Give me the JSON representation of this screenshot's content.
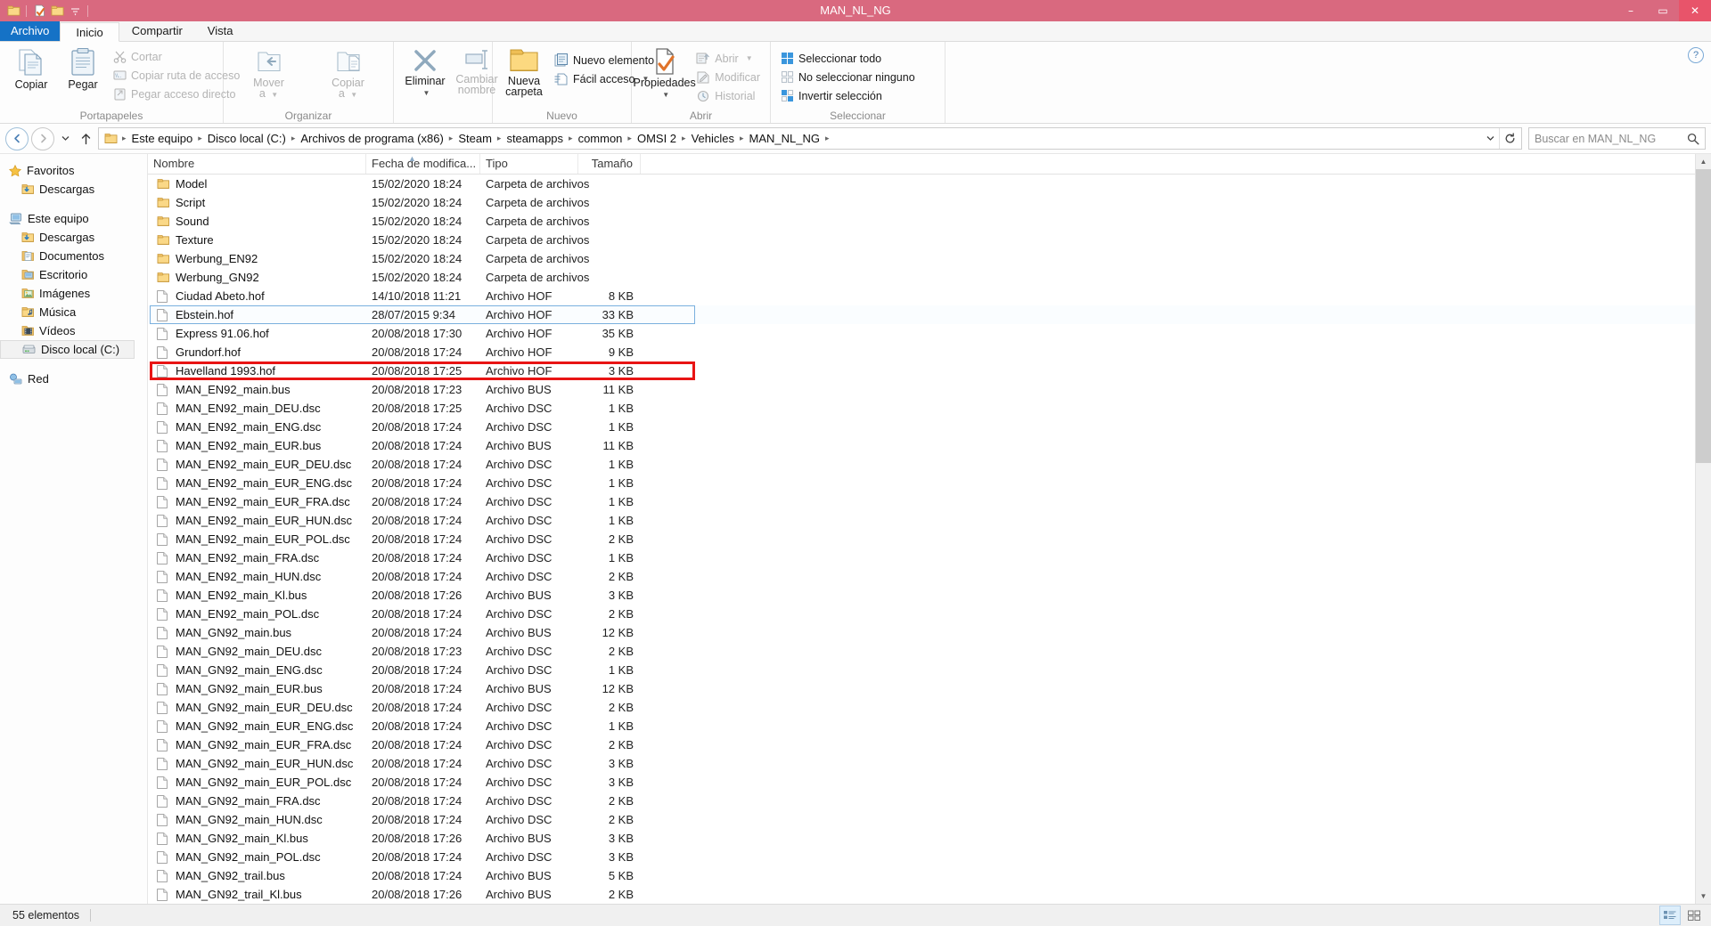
{
  "window": {
    "title": "MAN_NL_NG",
    "titlebar_color": "#d9697f",
    "accent_color": "#1572c6",
    "minimize": "–",
    "maximize": "▭",
    "close": "✕",
    "quick_access": [
      "folder-icon",
      "properties-icon",
      "new-folder-icon",
      "customize-qat-icon"
    ]
  },
  "tabs": [
    {
      "label": "Archivo",
      "type": "file"
    },
    {
      "label": "Inicio",
      "type": "active"
    },
    {
      "label": "Compartir",
      "type": "normal"
    },
    {
      "label": "Vista",
      "type": "normal"
    }
  ],
  "ribbon": {
    "help_label": "?",
    "groups": [
      {
        "name": "Portapapeles",
        "big": [
          {
            "label": "Copiar",
            "icon": "copy-icon",
            "dim": false
          },
          {
            "label": "Pegar",
            "icon": "paste-icon",
            "dim": false
          }
        ],
        "small": [
          {
            "label": "Cortar",
            "icon": "cut-icon",
            "dim": true
          },
          {
            "label": "Copiar ruta de acceso",
            "icon": "copy-path-icon",
            "dim": true
          },
          {
            "label": "Pegar acceso directo",
            "icon": "paste-shortcut-icon",
            "dim": true
          }
        ]
      },
      {
        "name": "Organizar",
        "big": [
          {
            "label": "Mover\na",
            "icon": "move-to-icon",
            "dim": true,
            "caret": true
          },
          {
            "label": "Copiar\na",
            "icon": "copy-to-icon",
            "dim": true,
            "caret": true
          },
          {
            "label": "Eliminar",
            "icon": "delete-icon",
            "dim": false,
            "caret": true
          },
          {
            "label": "Cambiar\nnombre",
            "icon": "rename-icon",
            "dim": true,
            "caret": false
          }
        ],
        "small": []
      },
      {
        "name": "Nuevo",
        "big": [
          {
            "label": "Nueva\ncarpeta",
            "icon": "new-folder-icon",
            "dim": false
          }
        ],
        "small": [
          {
            "label": "Nuevo elemento",
            "icon": "new-item-icon",
            "dim": false,
            "caret": true
          },
          {
            "label": "Fácil acceso",
            "icon": "easy-access-icon",
            "dim": false,
            "caret": true
          }
        ]
      },
      {
        "name": "Abrir",
        "big": [
          {
            "label": "Propiedades",
            "icon": "properties-icon",
            "dim": false,
            "caret": true
          }
        ],
        "small": [
          {
            "label": "Abrir",
            "icon": "open-icon",
            "dim": true,
            "caret": true
          },
          {
            "label": "Modificar",
            "icon": "edit-icon",
            "dim": true
          },
          {
            "label": "Historial",
            "icon": "history-icon",
            "dim": true
          }
        ]
      },
      {
        "name": "Seleccionar",
        "big": [],
        "small": [
          {
            "label": "Seleccionar todo",
            "icon": "select-all-icon",
            "dim": false
          },
          {
            "label": "No seleccionar ninguno",
            "icon": "select-none-icon",
            "dim": false
          },
          {
            "label": "Invertir selección",
            "icon": "invert-selection-icon",
            "dim": false
          }
        ]
      }
    ]
  },
  "address": {
    "back_icon": "back-arrow-icon",
    "forward_icon": "forward-arrow-icon",
    "recent_icon": "chevron-down-icon",
    "up_icon": "up-arrow-icon",
    "breadcrumbs": [
      "Este equipo",
      "Disco local (C:)",
      "Archivos de programa (x86)",
      "Steam",
      "steamapps",
      "common",
      "OMSI 2",
      "Vehicles",
      "MAN_NL_NG"
    ],
    "dropdown_icon": "chevron-down-icon",
    "refresh_icon": "refresh-icon",
    "separator": "▸"
  },
  "search": {
    "placeholder": "Buscar en MAN_NL_NG",
    "icon": "search-icon",
    "value": ""
  },
  "nav_pane": {
    "sections": [
      {
        "header": {
          "label": "Favoritos",
          "icon": "star-icon"
        },
        "items": [
          {
            "label": "Descargas",
            "icon": "downloads-folder-icon"
          }
        ]
      },
      {
        "header": {
          "label": "Este equipo",
          "icon": "computer-icon"
        },
        "items": [
          {
            "label": "Descargas",
            "icon": "downloads-folder-icon"
          },
          {
            "label": "Documentos",
            "icon": "documents-folder-icon"
          },
          {
            "label": "Escritorio",
            "icon": "desktop-folder-icon"
          },
          {
            "label": "Imágenes",
            "icon": "pictures-folder-icon"
          },
          {
            "label": "Música",
            "icon": "music-folder-icon"
          },
          {
            "label": "Vídeos",
            "icon": "videos-folder-icon"
          },
          {
            "label": "Disco local (C:)",
            "icon": "drive-icon",
            "selected": true
          }
        ]
      },
      {
        "header": {
          "label": "Red",
          "icon": "network-icon"
        },
        "items": []
      }
    ]
  },
  "file_list": {
    "columns": [
      {
        "label": "Nombre",
        "key": "name"
      },
      {
        "label": "Fecha de modifica...",
        "key": "date"
      },
      {
        "label": "Tipo",
        "key": "type"
      },
      {
        "label": "Tamaño",
        "key": "size"
      }
    ],
    "sort_column": "Nombre",
    "sort_direction": "asc",
    "rows": [
      {
        "name": "Model",
        "date": "15/02/2020 18:24",
        "type": "Carpeta de archivos",
        "size": "",
        "icon": "folder-icon"
      },
      {
        "name": "Script",
        "date": "15/02/2020 18:24",
        "type": "Carpeta de archivos",
        "size": "",
        "icon": "folder-icon"
      },
      {
        "name": "Sound",
        "date": "15/02/2020 18:24",
        "type": "Carpeta de archivos",
        "size": "",
        "icon": "folder-icon"
      },
      {
        "name": "Texture",
        "date": "15/02/2020 18:24",
        "type": "Carpeta de archivos",
        "size": "",
        "icon": "folder-icon"
      },
      {
        "name": "Werbung_EN92",
        "date": "15/02/2020 18:24",
        "type": "Carpeta de archivos",
        "size": "",
        "icon": "folder-icon"
      },
      {
        "name": "Werbung_GN92",
        "date": "15/02/2020 18:24",
        "type": "Carpeta de archivos",
        "size": "",
        "icon": "folder-icon"
      },
      {
        "name": "Ciudad Abeto.hof",
        "date": "14/10/2018 11:21",
        "type": "Archivo HOF",
        "size": "8 KB",
        "icon": "file-icon"
      },
      {
        "name": "Ebstein.hof",
        "date": "28/07/2015 9:34",
        "type": "Archivo HOF",
        "size": "33 KB",
        "icon": "file-icon",
        "selected": true
      },
      {
        "name": "Express 91.06.hof",
        "date": "20/08/2018 17:30",
        "type": "Archivo HOF",
        "size": "35 KB",
        "icon": "file-icon"
      },
      {
        "name": "Grundorf.hof",
        "date": "20/08/2018 17:24",
        "type": "Archivo HOF",
        "size": "9 KB",
        "icon": "file-icon",
        "highlighted": true
      },
      {
        "name": "Havelland 1993.hof",
        "date": "20/08/2018 17:25",
        "type": "Archivo HOF",
        "size": "3 KB",
        "icon": "file-icon"
      },
      {
        "name": "MAN_EN92_main.bus",
        "date": "20/08/2018 17:23",
        "type": "Archivo BUS",
        "size": "11 KB",
        "icon": "file-icon"
      },
      {
        "name": "MAN_EN92_main_DEU.dsc",
        "date": "20/08/2018 17:25",
        "type": "Archivo DSC",
        "size": "1 KB",
        "icon": "file-icon"
      },
      {
        "name": "MAN_EN92_main_ENG.dsc",
        "date": "20/08/2018 17:24",
        "type": "Archivo DSC",
        "size": "1 KB",
        "icon": "file-icon"
      },
      {
        "name": "MAN_EN92_main_EUR.bus",
        "date": "20/08/2018 17:24",
        "type": "Archivo BUS",
        "size": "11 KB",
        "icon": "file-icon"
      },
      {
        "name": "MAN_EN92_main_EUR_DEU.dsc",
        "date": "20/08/2018 17:24",
        "type": "Archivo DSC",
        "size": "1 KB",
        "icon": "file-icon"
      },
      {
        "name": "MAN_EN92_main_EUR_ENG.dsc",
        "date": "20/08/2018 17:24",
        "type": "Archivo DSC",
        "size": "1 KB",
        "icon": "file-icon"
      },
      {
        "name": "MAN_EN92_main_EUR_FRA.dsc",
        "date": "20/08/2018 17:24",
        "type": "Archivo DSC",
        "size": "1 KB",
        "icon": "file-icon"
      },
      {
        "name": "MAN_EN92_main_EUR_HUN.dsc",
        "date": "20/08/2018 17:24",
        "type": "Archivo DSC",
        "size": "1 KB",
        "icon": "file-icon"
      },
      {
        "name": "MAN_EN92_main_EUR_POL.dsc",
        "date": "20/08/2018 17:24",
        "type": "Archivo DSC",
        "size": "2 KB",
        "icon": "file-icon"
      },
      {
        "name": "MAN_EN92_main_FRA.dsc",
        "date": "20/08/2018 17:24",
        "type": "Archivo DSC",
        "size": "1 KB",
        "icon": "file-icon"
      },
      {
        "name": "MAN_EN92_main_HUN.dsc",
        "date": "20/08/2018 17:24",
        "type": "Archivo DSC",
        "size": "2 KB",
        "icon": "file-icon"
      },
      {
        "name": "MAN_EN92_main_Kl.bus",
        "date": "20/08/2018 17:26",
        "type": "Archivo BUS",
        "size": "3 KB",
        "icon": "file-icon"
      },
      {
        "name": "MAN_EN92_main_POL.dsc",
        "date": "20/08/2018 17:24",
        "type": "Archivo DSC",
        "size": "2 KB",
        "icon": "file-icon"
      },
      {
        "name": "MAN_GN92_main.bus",
        "date": "20/08/2018 17:24",
        "type": "Archivo BUS",
        "size": "12 KB",
        "icon": "file-icon"
      },
      {
        "name": "MAN_GN92_main_DEU.dsc",
        "date": "20/08/2018 17:23",
        "type": "Archivo DSC",
        "size": "2 KB",
        "icon": "file-icon"
      },
      {
        "name": "MAN_GN92_main_ENG.dsc",
        "date": "20/08/2018 17:24",
        "type": "Archivo DSC",
        "size": "1 KB",
        "icon": "file-icon"
      },
      {
        "name": "MAN_GN92_main_EUR.bus",
        "date": "20/08/2018 17:24",
        "type": "Archivo BUS",
        "size": "12 KB",
        "icon": "file-icon"
      },
      {
        "name": "MAN_GN92_main_EUR_DEU.dsc",
        "date": "20/08/2018 17:24",
        "type": "Archivo DSC",
        "size": "2 KB",
        "icon": "file-icon"
      },
      {
        "name": "MAN_GN92_main_EUR_ENG.dsc",
        "date": "20/08/2018 17:24",
        "type": "Archivo DSC",
        "size": "1 KB",
        "icon": "file-icon"
      },
      {
        "name": "MAN_GN92_main_EUR_FRA.dsc",
        "date": "20/08/2018 17:24",
        "type": "Archivo DSC",
        "size": "2 KB",
        "icon": "file-icon"
      },
      {
        "name": "MAN_GN92_main_EUR_HUN.dsc",
        "date": "20/08/2018 17:24",
        "type": "Archivo DSC",
        "size": "3 KB",
        "icon": "file-icon"
      },
      {
        "name": "MAN_GN92_main_EUR_POL.dsc",
        "date": "20/08/2018 17:24",
        "type": "Archivo DSC",
        "size": "3 KB",
        "icon": "file-icon"
      },
      {
        "name": "MAN_GN92_main_FRA.dsc",
        "date": "20/08/2018 17:24",
        "type": "Archivo DSC",
        "size": "2 KB",
        "icon": "file-icon"
      },
      {
        "name": "MAN_GN92_main_HUN.dsc",
        "date": "20/08/2018 17:24",
        "type": "Archivo DSC",
        "size": "2 KB",
        "icon": "file-icon"
      },
      {
        "name": "MAN_GN92_main_Kl.bus",
        "date": "20/08/2018 17:26",
        "type": "Archivo BUS",
        "size": "3 KB",
        "icon": "file-icon"
      },
      {
        "name": "MAN_GN92_main_POL.dsc",
        "date": "20/08/2018 17:24",
        "type": "Archivo DSC",
        "size": "3 KB",
        "icon": "file-icon"
      },
      {
        "name": "MAN_GN92_trail.bus",
        "date": "20/08/2018 17:24",
        "type": "Archivo BUS",
        "size": "5 KB",
        "icon": "file-icon"
      },
      {
        "name": "MAN_GN92_trail_Kl.bus",
        "date": "20/08/2018 17:26",
        "type": "Archivo BUS",
        "size": "2 KB",
        "icon": "file-icon"
      }
    ]
  },
  "status_bar": {
    "item_count": "55 elementos",
    "view_details_icon": "details-view-icon",
    "view_large_icon": "large-icons-view-icon"
  }
}
